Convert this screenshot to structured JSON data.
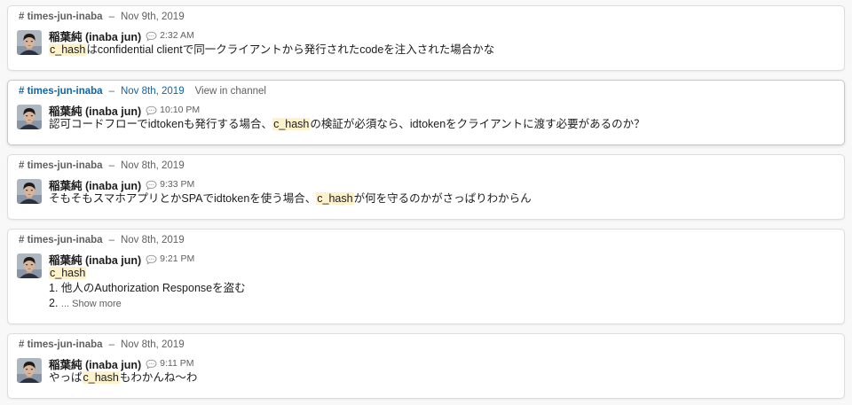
{
  "results": [
    {
      "channel": "# times-jun-inaba",
      "separator": "–",
      "date": "Nov 9th, 2019",
      "view_in_channel": "",
      "author": "稲葉純 (inaba jun)",
      "time": "2:32 AM",
      "lines": [
        {
          "parts": [
            {
              "text": "c_hash",
              "hl": true
            },
            {
              "text": "はconfidential clientで同一クライアントから発行されたcodeを注入された場合かな",
              "hl": false
            }
          ]
        }
      ]
    },
    {
      "channel": "# times-jun-inaba",
      "separator": "–",
      "date": "Nov 8th, 2019",
      "view_in_channel": "View in channel",
      "author": "稲葉純 (inaba jun)",
      "time": "10:10 PM",
      "lines": [
        {
          "parts": [
            {
              "text": "認可コードフローでidtokenも発行する場合、",
              "hl": false
            },
            {
              "text": "c_hash",
              "hl": true
            },
            {
              "text": "の検証が必須なら、idtokenをクライアントに渡す必要があるのか？",
              "hl": false
            }
          ]
        }
      ]
    },
    {
      "channel": "# times-jun-inaba",
      "separator": "–",
      "date": "Nov 8th, 2019",
      "view_in_channel": "",
      "author": "稲葉純 (inaba jun)",
      "time": "9:33 PM",
      "lines": [
        {
          "parts": [
            {
              "text": "そもそもスマホアプリとかSPAでidtokenを使う場合、",
              "hl": false
            },
            {
              "text": "c_hash",
              "hl": true
            },
            {
              "text": "が何を守るのかがさっぱりわからん",
              "hl": false
            }
          ]
        }
      ]
    },
    {
      "channel": "# times-jun-inaba",
      "separator": "–",
      "date": "Nov 8th, 2019",
      "view_in_channel": "",
      "author": "稲葉純 (inaba jun)",
      "time": "9:21 PM",
      "lines": [
        {
          "parts": [
            {
              "text": "c_hash",
              "hl": true
            }
          ]
        },
        {
          "parts": [
            {
              "text": "1. 他人のAuthorization Responseを盗む",
              "hl": false
            }
          ]
        },
        {
          "parts": [
            {
              "text": "2. ",
              "hl": false
            }
          ],
          "more": "... Show more"
        }
      ]
    },
    {
      "channel": "# times-jun-inaba",
      "separator": "–",
      "date": "Nov 8th, 2019",
      "view_in_channel": "",
      "author": "稲葉純 (inaba jun)",
      "time": "9:11 PM",
      "lines": [
        {
          "parts": [
            {
              "text": "やっぱ",
              "hl": false
            },
            {
              "text": "c_hash",
              "hl": true
            },
            {
              "text": "もわかんね〜わ",
              "hl": false
            }
          ]
        }
      ]
    }
  ],
  "icons": {
    "avatar": "user-avatar",
    "thread": "speech-bubble-icon"
  },
  "colors": {
    "highlight": "#fdf2cc",
    "link": "#1264a3",
    "muted": "#616061"
  }
}
